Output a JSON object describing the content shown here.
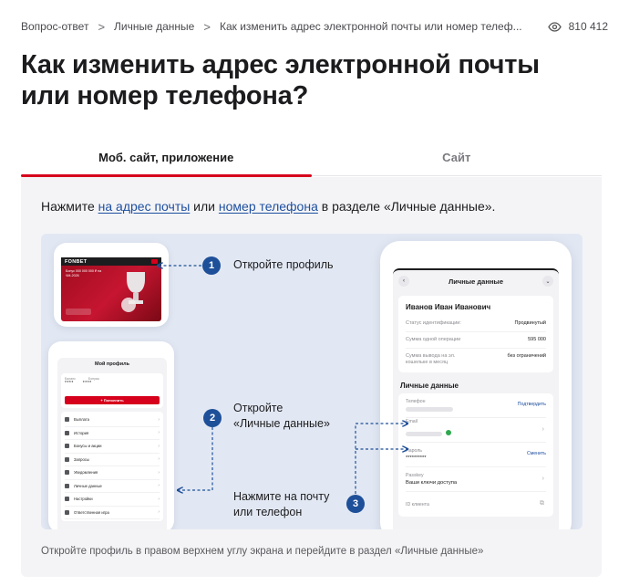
{
  "breadcrumb": {
    "items": [
      "Вопрос-ответ",
      "Личные данные",
      "Как изменить адрес электронной почты или номер телеф..."
    ],
    "separator": ">",
    "views": "810 412"
  },
  "page_title": "Как изменить адрес электронной почты или номер телефона?",
  "tabs": [
    {
      "label": "Моб. сайт, приложение",
      "active": true
    },
    {
      "label": "Сайт",
      "active": false
    }
  ],
  "instruction": {
    "before": "Нажмите ",
    "link1": "на адрес почты",
    "middle": " или ",
    "link2": "номер телефона",
    "after": " в разделе «Личные данные»."
  },
  "illustration": {
    "steps": [
      {
        "num": "1",
        "text": "Откройте профиль"
      },
      {
        "num": "2",
        "text": "Откройте «Личные данные»"
      },
      {
        "num": "3",
        "text": "Нажмите на почту или телефон"
      }
    ],
    "step2_line1": "Откройте",
    "step2_line2": "«Личные данные»",
    "step3_line1": "Нажмите на почту",
    "step3_line2": "или телефон",
    "phone1": {
      "logo": "FONBET",
      "promo": "Бонус 000 000 000 ₽ на ЧМ-2026"
    },
    "phone2": {
      "title": "Мой профиль",
      "balance_labels": [
        "Баланс",
        "Бонусы"
      ],
      "balance_values": [
        "****",
        "****"
      ],
      "topup_button": "+ Пополнить",
      "menu": [
        "Выплата",
        "История",
        "Бонусы и акции",
        "Запросы",
        "Уведомления",
        "Личные данные",
        "Настройки",
        "Ответственная игра"
      ]
    },
    "phone3": {
      "title": "Личные данные",
      "name": "Иванов Иван Иванович",
      "info": [
        {
          "k": "Статус идентификации:",
          "v": "Продвинутый"
        },
        {
          "k": "Сумма одной операции",
          "v": "595 000"
        },
        {
          "k": "Сумма вывода на эл. кошельке в месяц",
          "v": "без ограничений"
        }
      ],
      "section": "Личные данные",
      "fields": [
        {
          "label": "Телефон",
          "action": "Подтвердить"
        },
        {
          "label": "Email"
        },
        {
          "label": "Пароль",
          "value": "**********",
          "action": "Сменить"
        },
        {
          "label": "Passkey",
          "value": "Ваши ключи доступа"
        },
        {
          "label": "ID клиента"
        }
      ]
    }
  },
  "caption": "Откройте профиль в правом верхнем углу экрана и перейдите в раздел «Личные данные»",
  "colors": {
    "accent": "#d6001c",
    "link": "#1f4fa0",
    "step": "#1e4f99"
  }
}
